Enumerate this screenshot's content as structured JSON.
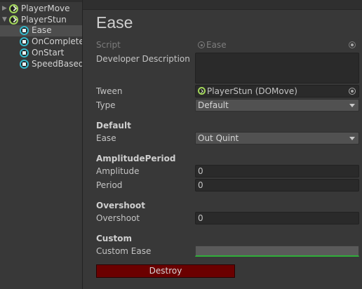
{
  "hierarchy": {
    "items": [
      {
        "label": "PlayerMove",
        "kind": "player",
        "foldout": "collapsed"
      },
      {
        "label": "PlayerStun",
        "kind": "player",
        "foldout": "expanded"
      },
      {
        "label": "Ease",
        "kind": "node",
        "selected": true
      },
      {
        "label": "OnComplete",
        "kind": "node"
      },
      {
        "label": "OnStart",
        "kind": "node"
      },
      {
        "label": "SpeedBased",
        "kind": "node"
      }
    ]
  },
  "inspector": {
    "title": "Ease",
    "script_label": "Script",
    "script_value": "Ease",
    "dev_desc_label": "Developer Description",
    "dev_desc_value": "",
    "tween_label": "Tween",
    "tween_value": "PlayerStun (DOMove)",
    "type_label": "Type",
    "type_value": "Default",
    "default_header": "Default",
    "ease_label": "Ease",
    "ease_value": "Out Quint",
    "amp_header": "AmplitudePeriod",
    "amplitude_label": "Amplitude",
    "amplitude_value": "0",
    "period_label": "Period",
    "period_value": "0",
    "overshoot_header": "Overshoot",
    "overshoot_label": "Overshoot",
    "overshoot_value": "0",
    "custom_header": "Custom",
    "custom_ease_label": "Custom Ease",
    "destroy_label": "Destroy"
  },
  "colors": {
    "background": "#383838",
    "field": "#2a2a2a",
    "dropdown": "#515151",
    "destroy": "#6b0000",
    "curve_line": "#2fae3a",
    "player_icon": "#a2d65a",
    "node_icon": "#35b7c9"
  }
}
